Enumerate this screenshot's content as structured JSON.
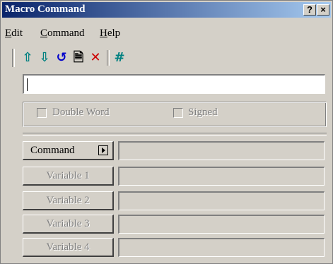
{
  "window": {
    "title": "Macro Command"
  },
  "titlebar": {
    "help_label": "?",
    "close_label": "×"
  },
  "menu": [
    {
      "label": "Edit",
      "accel": "E"
    },
    {
      "label": "Command",
      "accel": "C"
    },
    {
      "label": "Help",
      "accel": "H"
    }
  ],
  "toolbar": {
    "icons": [
      {
        "name": "move-up-icon",
        "glyph": "⇧",
        "color": "#008080"
      },
      {
        "name": "move-down-icon",
        "glyph": "⇩",
        "color": "#008080"
      },
      {
        "name": "undo-icon",
        "glyph": "↺",
        "color": "#0000cc"
      },
      {
        "name": "document-icon",
        "glyph": "🗎",
        "color": "#000000"
      },
      {
        "name": "delete-icon",
        "glyph": "✕",
        "color": "#cc0000"
      },
      {
        "name": "hash-icon",
        "glyph": "#",
        "color": "#008080"
      }
    ]
  },
  "command_input": {
    "value": ""
  },
  "options": {
    "double_word": "Double Word",
    "signed": "Signed"
  },
  "rows": [
    {
      "label": "Command",
      "enabled": true
    },
    {
      "label": "Variable 1",
      "enabled": false
    },
    {
      "label": "Variable 2",
      "enabled": false
    },
    {
      "label": "Variable 3",
      "enabled": false
    },
    {
      "label": "Variable 4",
      "enabled": false
    }
  ],
  "colors": {
    "titlebar_start": "#0a246a",
    "titlebar_end": "#a6caf0",
    "face": "#d4d0c8"
  }
}
